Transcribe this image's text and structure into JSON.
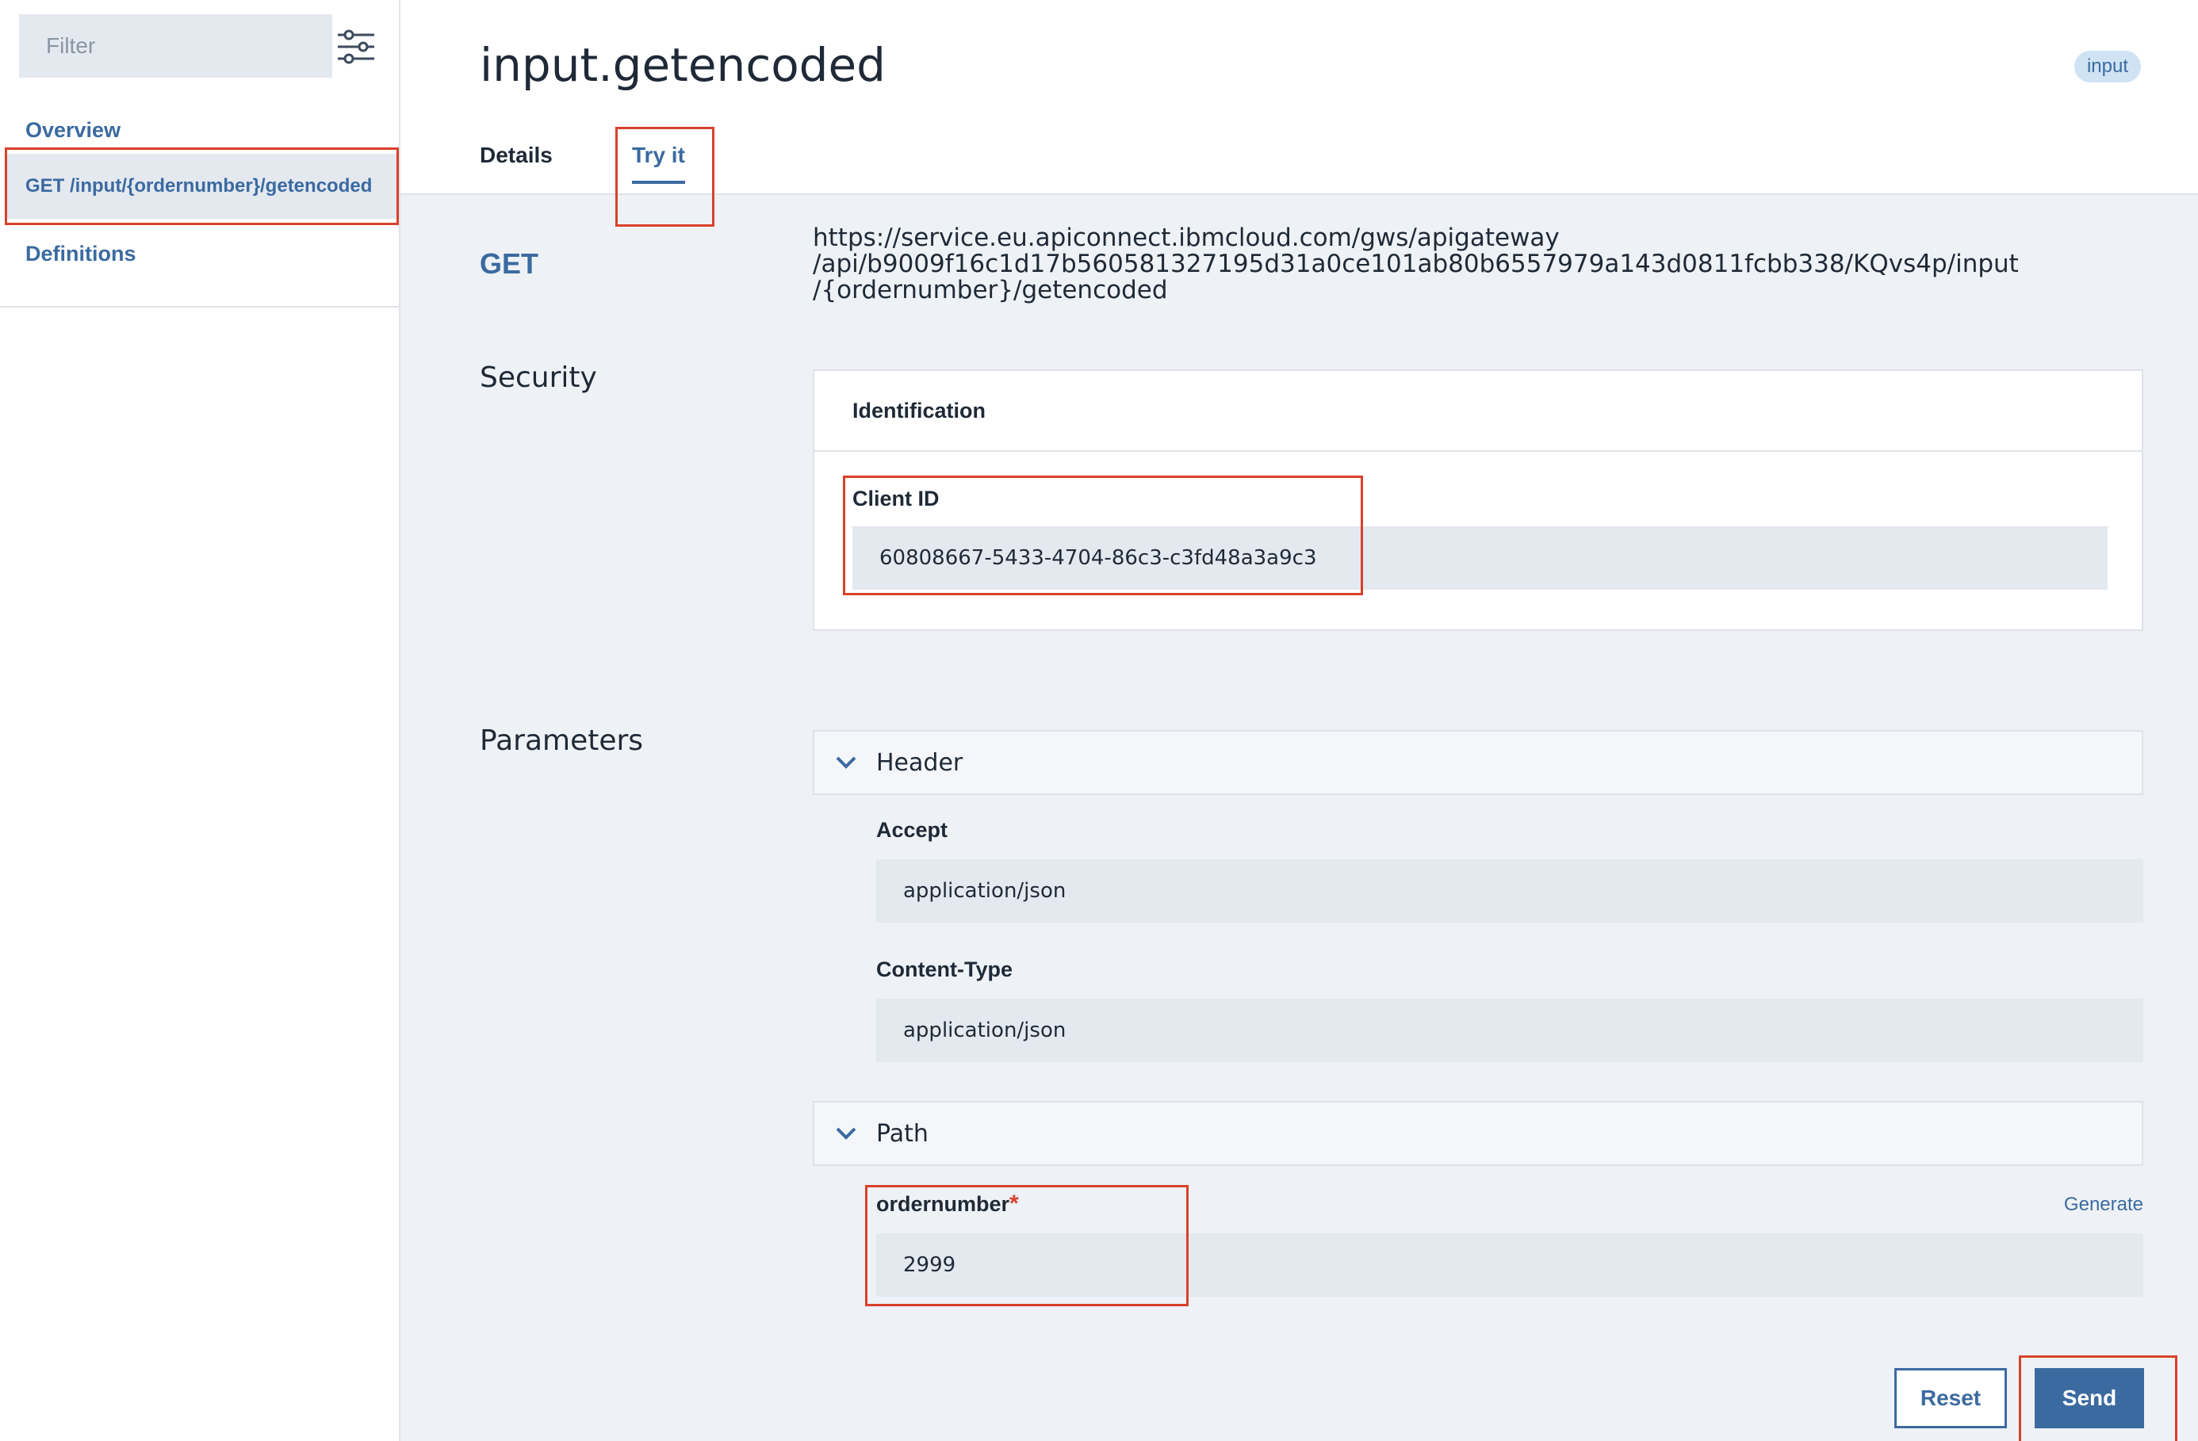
{
  "sidebar": {
    "filter_placeholder": "Filter",
    "items": [
      {
        "label": "Overview"
      },
      {
        "label": "GET /input/{ordernumber}/getencoded"
      },
      {
        "label": "Definitions"
      }
    ]
  },
  "header": {
    "title": "input.getencoded",
    "tag": "input",
    "tabs": [
      {
        "label": "Details"
      },
      {
        "label": "Try it"
      }
    ]
  },
  "request": {
    "method": "GET",
    "url_lines": [
      "https://service.eu.apiconnect.ibmcloud.com/gws/apigateway",
      "/api/b9009f16c1d17b560581327195d31a0ce101ab80b6557979a143d0811fcbb338/KQvs4p/input",
      "/{ordernumber}/getencoded"
    ]
  },
  "security": {
    "section_label": "Security",
    "card_title": "Identification",
    "client_id_label": "Client ID",
    "client_id_value": "60808667-5433-4704-86c3-c3fd48a3a9c3"
  },
  "parameters": {
    "section_label": "Parameters",
    "header_group": {
      "title": "Header",
      "fields": [
        {
          "label": "Accept",
          "value": "application/json"
        },
        {
          "label": "Content-Type",
          "value": "application/json"
        }
      ]
    },
    "path_group": {
      "title": "Path",
      "fields": [
        {
          "label": "ordernumber",
          "required_marker": "*",
          "value": "2999",
          "generate_label": "Generate"
        }
      ]
    }
  },
  "actions": {
    "reset_label": "Reset",
    "send_label": "Send"
  },
  "colors": {
    "accent": "#3b6aa0",
    "highlight": "#d9412b",
    "input_bg": "#e4e9f0",
    "page_bg": "#eef2f6"
  }
}
